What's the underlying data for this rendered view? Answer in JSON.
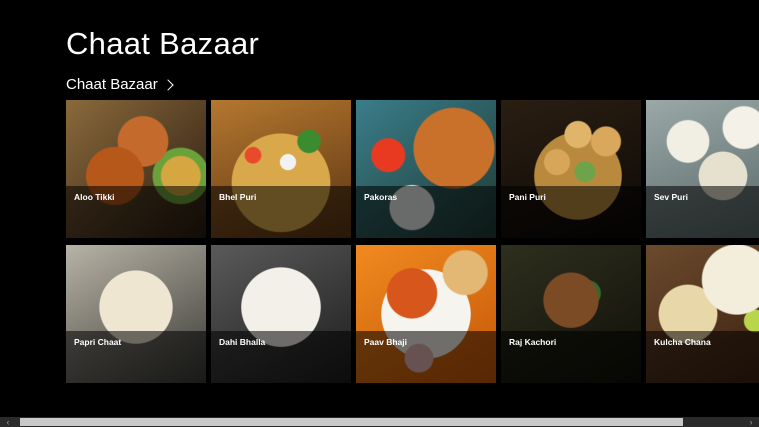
{
  "app": {
    "title": "Chaat Bazaar"
  },
  "group": {
    "header": "Chaat Bazaar"
  },
  "items": [
    {
      "label": "Aloo Tikki"
    },
    {
      "label": "Bhel Puri"
    },
    {
      "label": "Pakoras"
    },
    {
      "label": "Pani Puri"
    },
    {
      "label": "Sev Puri"
    },
    {
      "label": "Papri Chaat"
    },
    {
      "label": "Dahi Bhalla"
    },
    {
      "label": "Paav Bhaji"
    },
    {
      "label": "Raj Kachori"
    },
    {
      "label": "Kulcha Chana"
    }
  ],
  "scroll": {
    "left_icon": "chevron-left-icon",
    "right_icon": "chevron-right-icon"
  },
  "colors": {
    "background": "#000000",
    "text": "#ffffff",
    "scroll_thumb": "#c9c9c9"
  }
}
